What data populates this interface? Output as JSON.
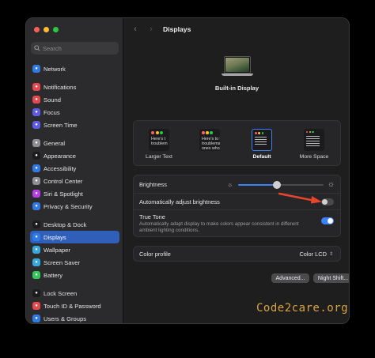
{
  "colors": {
    "accent": "#3b82f6",
    "sidebar_selection": "#2f5fb8",
    "arrow": "#e8452c",
    "watermark": "#d9a441"
  },
  "sidebar": {
    "search_placeholder": "Search",
    "items": [
      {
        "label": "Network",
        "icon": "globe-icon",
        "color": "#2f7ae5"
      },
      {
        "label": "Notifications",
        "icon": "bell-icon",
        "color": "#e5484d"
      },
      {
        "label": "Sound",
        "icon": "speaker-icon",
        "color": "#e5484d"
      },
      {
        "label": "Focus",
        "icon": "moon-icon",
        "color": "#5e5ce6"
      },
      {
        "label": "Screen Time",
        "icon": "hourglass-icon",
        "color": "#5e5ce6"
      },
      {
        "label": "General",
        "icon": "gear-icon",
        "color": "#8e8e93"
      },
      {
        "label": "Appearance",
        "icon": "appearance-icon",
        "color": "#1c1c1e"
      },
      {
        "label": "Accessibility",
        "icon": "accessibility-icon",
        "color": "#2f7ae5"
      },
      {
        "label": "Control Center",
        "icon": "control-center-icon",
        "color": "#8e8e93"
      },
      {
        "label": "Siri & Spotlight",
        "icon": "siri-icon",
        "color": "#b73ee6"
      },
      {
        "label": "Privacy & Security",
        "icon": "hand-icon",
        "color": "#2f7ae5"
      },
      {
        "label": "Desktop & Dock",
        "icon": "dock-icon",
        "color": "#1c1c1e"
      },
      {
        "label": "Displays",
        "icon": "display-icon",
        "color": "#2f7ae5"
      },
      {
        "label": "Wallpaper",
        "icon": "wallpaper-icon",
        "color": "#34aadc"
      },
      {
        "label": "Screen Saver",
        "icon": "screensaver-icon",
        "color": "#34aadc"
      },
      {
        "label": "Battery",
        "icon": "battery-icon",
        "color": "#34c759"
      },
      {
        "label": "Lock Screen",
        "icon": "lock-icon",
        "color": "#1c1c1e"
      },
      {
        "label": "Touch ID & Password",
        "icon": "fingerprint-icon",
        "color": "#e5484d"
      },
      {
        "label": "Users & Groups",
        "icon": "users-icon",
        "color": "#2f7ae5"
      }
    ],
    "selected": "Displays"
  },
  "header": {
    "title": "Displays"
  },
  "display": {
    "name": "Built-in Display"
  },
  "resolution": {
    "options": [
      {
        "label": "Larger Text",
        "preview": "Here's t\ntroublem"
      },
      {
        "label": "",
        "preview": "Here's to t\ntroublema\nones who"
      },
      {
        "label": "Default",
        "preview": ""
      },
      {
        "label": "More Space",
        "preview": ""
      }
    ],
    "selected": "Default"
  },
  "brightness": {
    "label": "Brightness",
    "level": 0.45,
    "auto_label": "Automatically adjust brightness",
    "auto_on": false
  },
  "true_tone": {
    "label": "True Tone",
    "description": "Automatically adapt display to make colors appear consistent in different ambient lighting conditions.",
    "on": true
  },
  "color_profile": {
    "label": "Color profile",
    "value": "Color LCD"
  },
  "footer": {
    "advanced_label": "Advanced...",
    "night_shift_label": "Night Shift...",
    "help_label": "?"
  },
  "watermark": "Code2care.org"
}
